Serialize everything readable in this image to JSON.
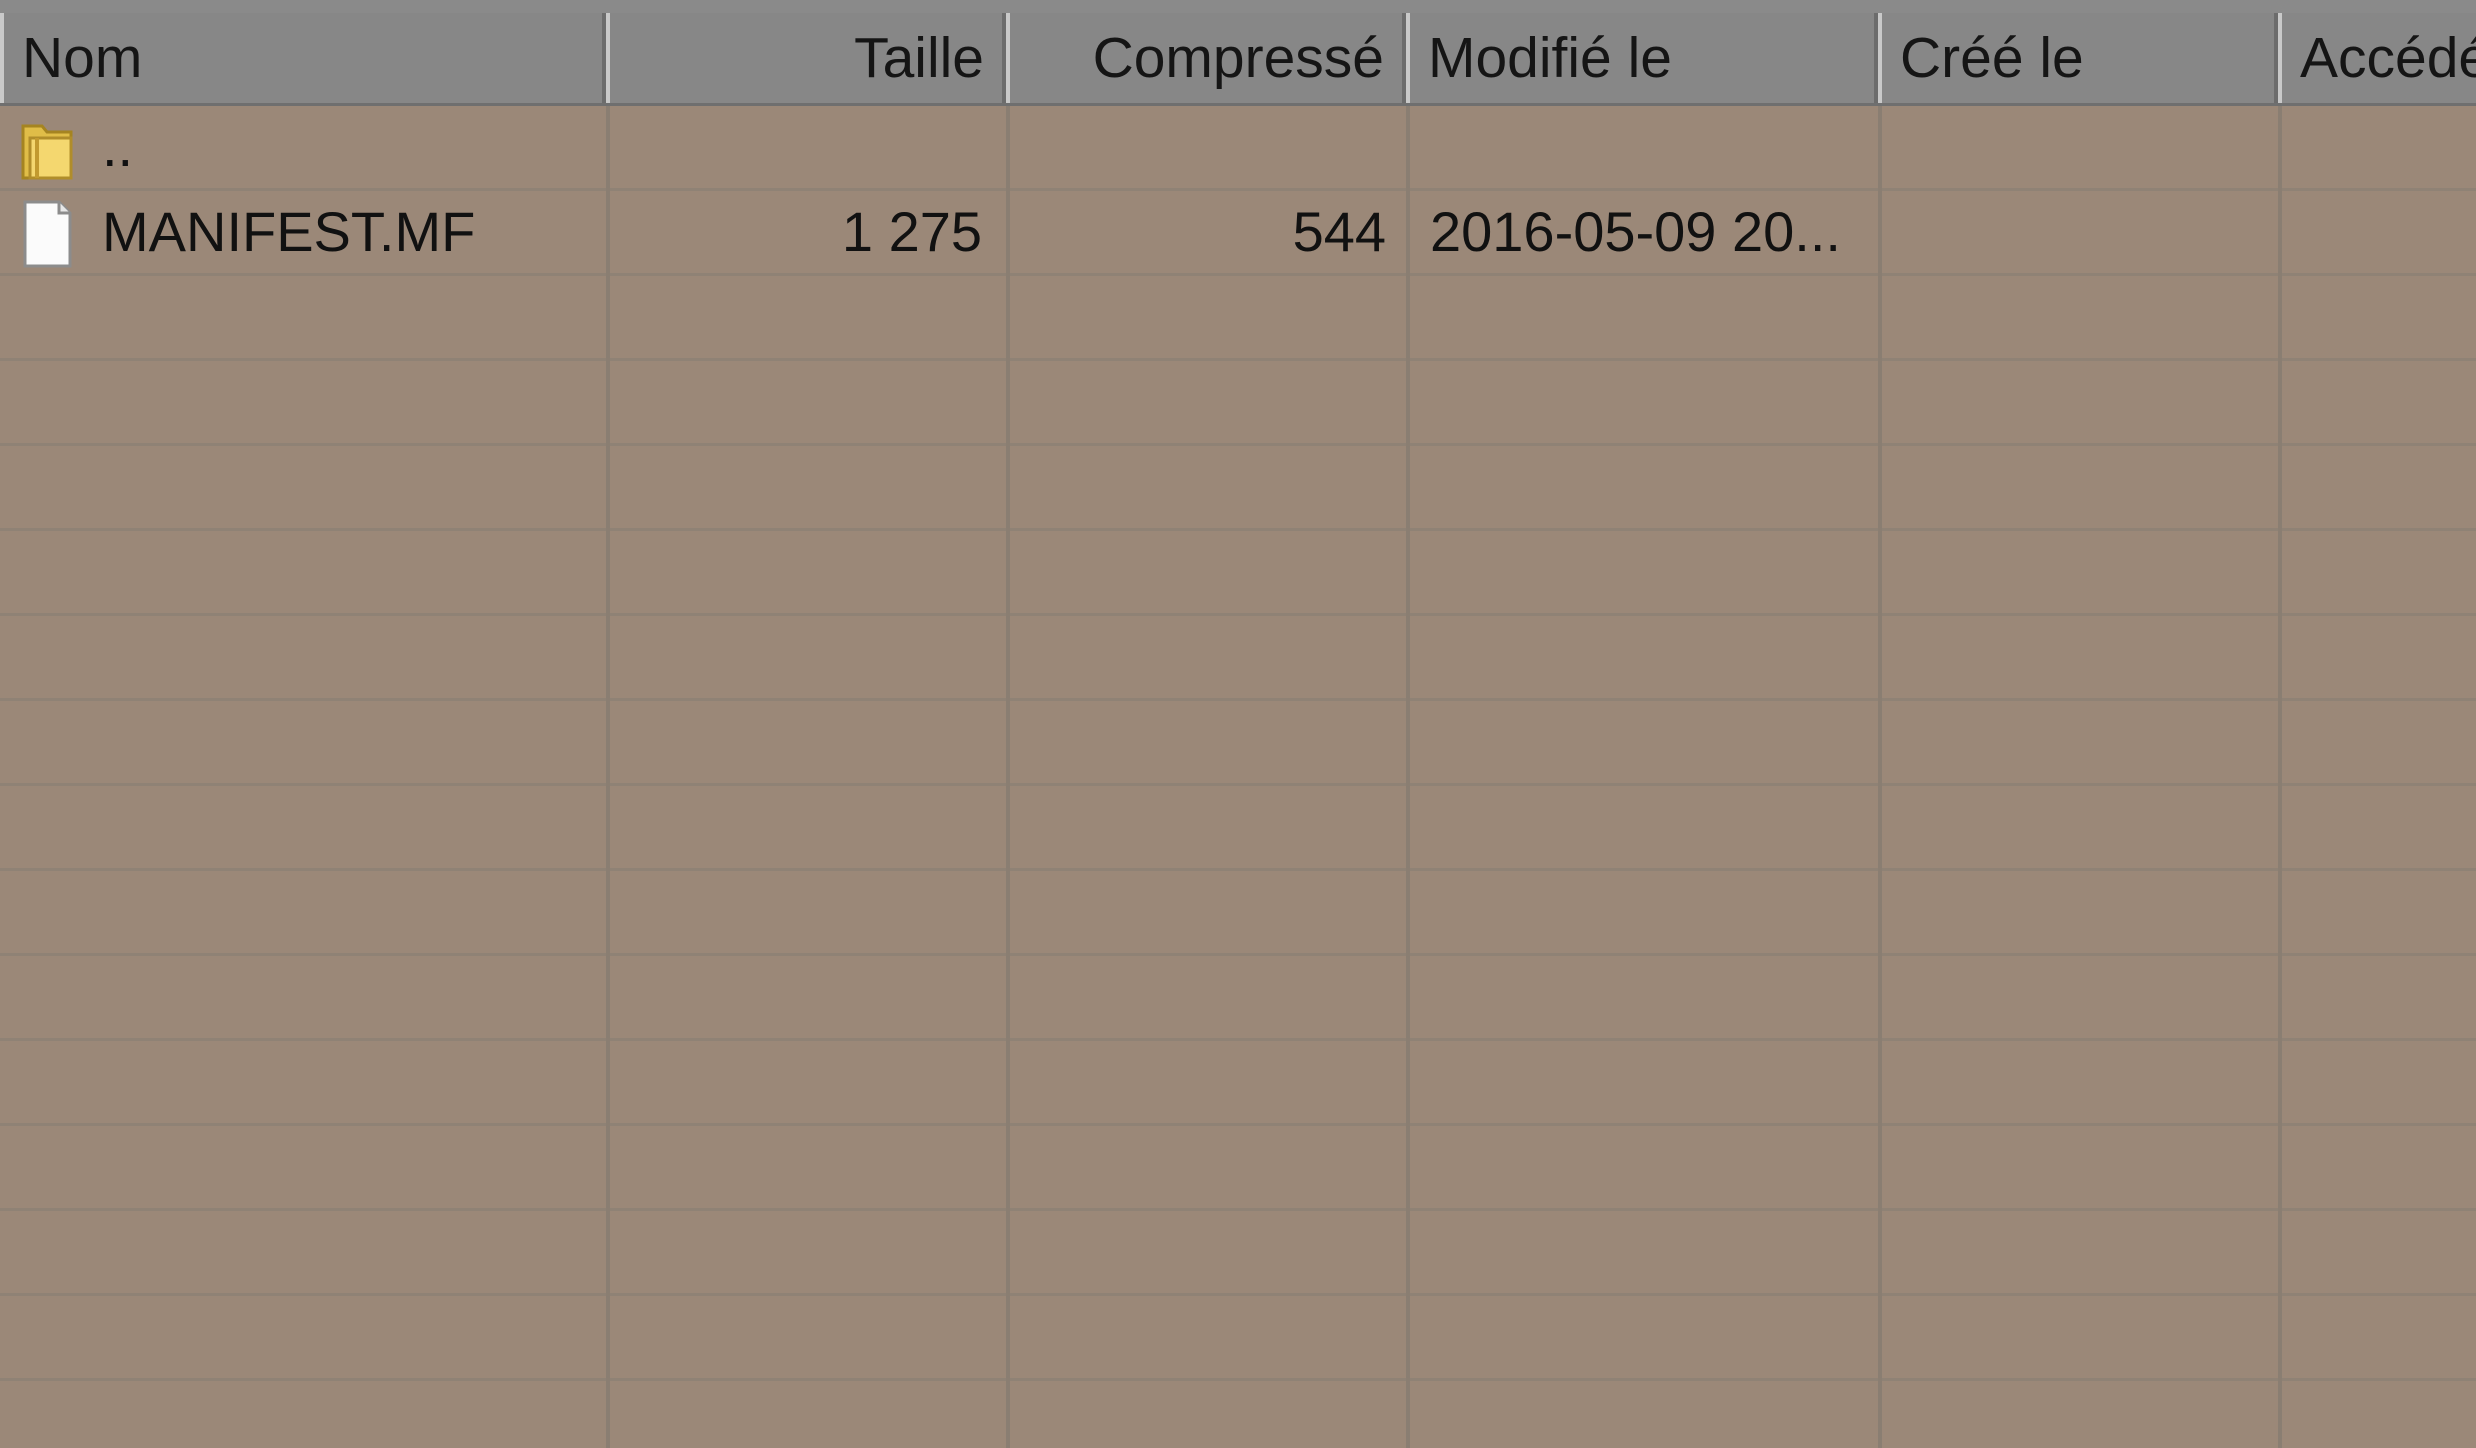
{
  "columns": {
    "name": "Nom",
    "size": "Taille",
    "compressed": "Compressé",
    "modified": "Modifié le",
    "created": "Créé le",
    "accessed": "Accédé"
  },
  "rows": [
    {
      "icon": "folder-icon",
      "name": "..",
      "size": "",
      "compressed": "",
      "modified": ""
    },
    {
      "icon": "file-icon",
      "name": "MANIFEST.MF",
      "size": "1 275",
      "compressed": "544",
      "modified": "2016-05-09 20..."
    }
  ]
}
